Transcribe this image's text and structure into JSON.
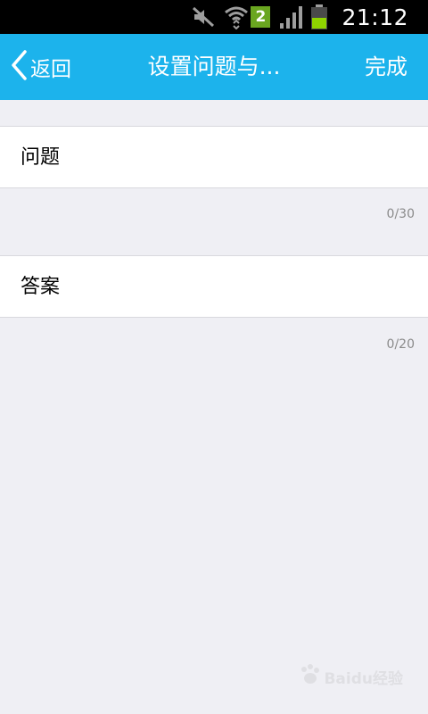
{
  "status_bar": {
    "time": "21:12",
    "sim_badge": "2",
    "icons": [
      "mute-icon",
      "wifi-icon",
      "sim-2-icon",
      "signal-icon",
      "battery-icon"
    ]
  },
  "nav": {
    "back_label": "返回",
    "title": "设置问题与...",
    "done_label": "完成",
    "bar_color": "#1cb3ec"
  },
  "form": {
    "question": {
      "placeholder": "问题",
      "value": "",
      "counter": "0/30"
    },
    "answer": {
      "placeholder": "答案",
      "value": "",
      "counter": "0/20"
    }
  },
  "watermark": {
    "text": "Baidu经验"
  }
}
